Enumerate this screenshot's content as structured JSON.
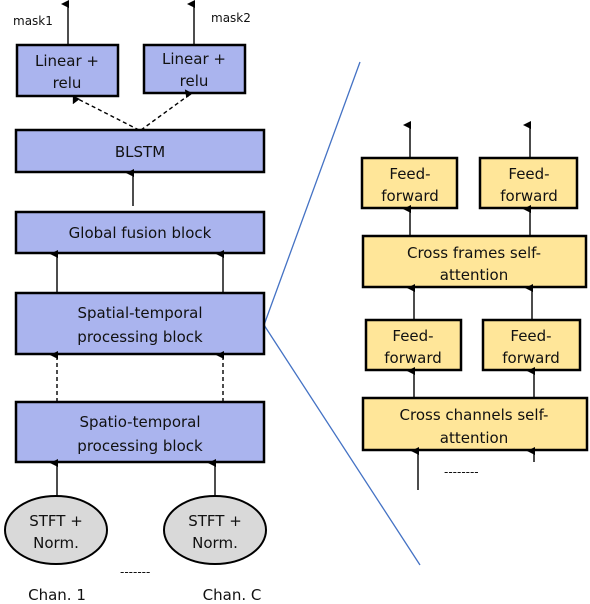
{
  "left": {
    "mask_labels": [
      "mask1",
      "mask2"
    ],
    "linear_relu": [
      "Linear +",
      "relu"
    ],
    "blstm": "BLSTM",
    "global_fusion": "Global fusion block",
    "spatial_temporal": [
      "Spatial-temporal",
      "processing block"
    ],
    "spatio_temporal": [
      "Spatio-temporal",
      "processing block"
    ],
    "stft": [
      "STFT +",
      "Norm."
    ],
    "channels": [
      "Chan. 1",
      "Chan. C"
    ],
    "ellipsis": "-------"
  },
  "right": {
    "feed_forward": [
      "Feed-",
      "forward"
    ],
    "cross_frames": [
      "Cross frames self-",
      "attention"
    ],
    "cross_channels": [
      "Cross channels self-",
      "attention"
    ],
    "ellipsis": "--------"
  },
  "colors": {
    "blue_block": "#aab4ee",
    "yellow_block": "#ffe699",
    "ellipse": "#d9d9d9",
    "connector": "#4472c4"
  }
}
